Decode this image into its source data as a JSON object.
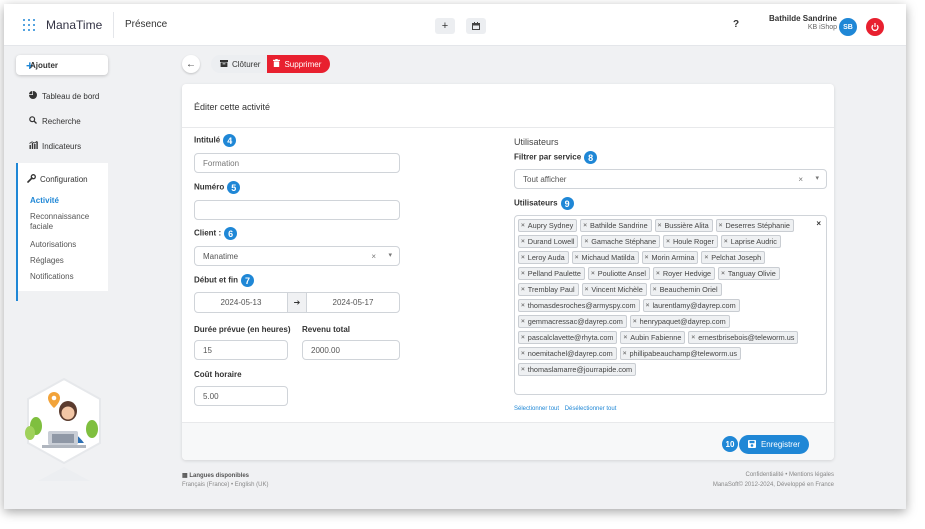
{
  "app": {
    "name": "ManaTime",
    "page_title": "Présence"
  },
  "toolbar": {
    "add_icon": "plus-icon",
    "calendar_icon": "calendar-icon",
    "help_label": "?"
  },
  "user": {
    "name": "Bathilde Sandrine",
    "company": "KB iShop",
    "initials": "SB"
  },
  "sidebar": {
    "add_label": "Ajouter",
    "items": [
      {
        "label": "Tableau de bord",
        "icon": "pie-chart-icon"
      },
      {
        "label": "Recherche",
        "icon": "search-icon"
      },
      {
        "label": "Indicateurs",
        "icon": "indicators-icon"
      }
    ],
    "config": {
      "label": "Configuration",
      "icon": "wrench-icon",
      "items": [
        "Activité",
        "Reconnaissance faciale",
        "Autorisations",
        "Réglages",
        "Notifications"
      ],
      "active": "Activité"
    }
  },
  "actions": {
    "close_label": "Clôturer",
    "delete_label": "Supprimer"
  },
  "form": {
    "title": "Éditer cette activité",
    "intitule": {
      "label": "Intitulé",
      "badge": "4",
      "placeholder": "Formation"
    },
    "numero": {
      "label": "Numéro",
      "badge": "5",
      "value": ""
    },
    "client": {
      "label": "Client :",
      "badge": "6",
      "value": "Manatime"
    },
    "dates": {
      "label": "Début et fin",
      "badge": "7",
      "start": "2024-05-13",
      "end": "2024-05-17"
    },
    "duree": {
      "label": "Durée prévue (en heures)",
      "value": "15"
    },
    "revenu": {
      "label": "Revenu total",
      "value": "2000.00"
    },
    "cout": {
      "label": "Coût horaire",
      "value": "5.00"
    },
    "users_section": "Utilisateurs",
    "filter": {
      "label": "Filtrer par service",
      "badge": "8",
      "value": "Tout afficher"
    },
    "users": {
      "label": "Utilisateurs",
      "badge": "9",
      "tags": [
        "Aupry Sydney",
        "Bathilde Sandrine",
        "Bussière Alita",
        "Deserres Stéphanie",
        "Durand Lowell",
        "Gamache Stéphane",
        "Houle Roger",
        "Laprise Audric",
        "Leroy Auda",
        "Michaud Matilda",
        "Morin Armina",
        "Pelchat Joseph",
        "Pelland Paulette",
        "Pouliotte Ansel",
        "Royer Hedvige",
        "Tanguay Olivie",
        "Tremblay Paul",
        "Vincent Michèle",
        "Beauchemin Oriel",
        "thomasdesroches@armyspy.com",
        "laurentlamy@dayrep.com",
        "gemmacressac@dayrep.com",
        "henrypaquet@dayrep.com",
        "pascalclavette@rhyta.com",
        "Aubin Fabienne",
        "ernestbrisebois@teleworm.us",
        "noemitachel@dayrep.com",
        "phillipabeauchamp@teleworm.us",
        "thomaslamarre@jourrapide.com"
      ]
    },
    "select_all": "Sélectionner tout",
    "deselect_all": "Désélectionner tout",
    "save_label": "Enregistrer",
    "save_badge": "10"
  },
  "footer": {
    "languages_title": "Langues disponibles",
    "languages": "Français (France) • English (UK)",
    "legal": "Confidentialité • Mentions légales",
    "copyright": "ManaSoft© 2012-2024, Développé en France"
  },
  "colors": {
    "accent": "#1f87d6",
    "danger": "#e8202f",
    "background": "#f0f1f3"
  }
}
